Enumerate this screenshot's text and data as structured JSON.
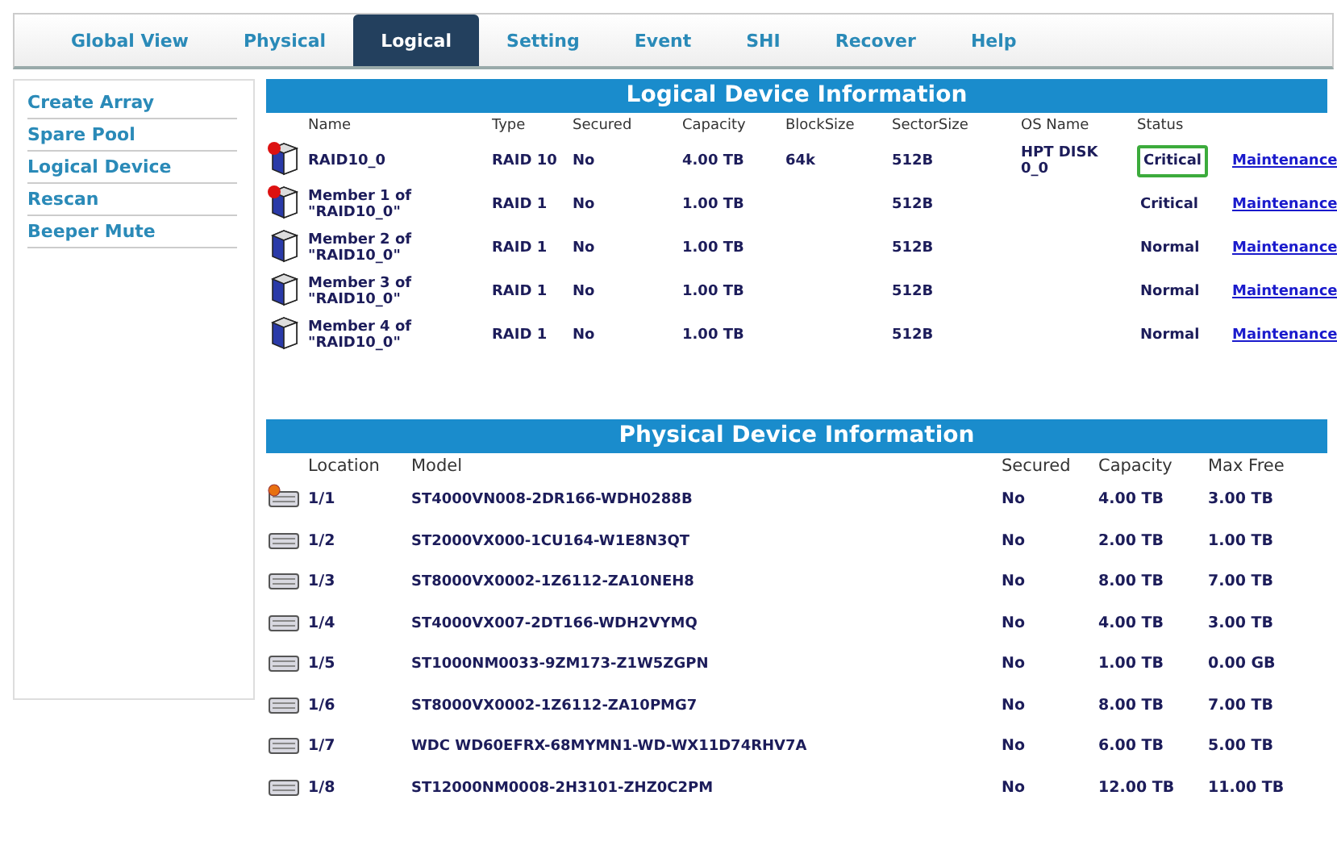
{
  "tabs": [
    {
      "label": "Global View",
      "selected": false
    },
    {
      "label": "Physical",
      "selected": false
    },
    {
      "label": "Logical",
      "selected": true
    },
    {
      "label": "Setting",
      "selected": false
    },
    {
      "label": "Event",
      "selected": false
    },
    {
      "label": "SHI",
      "selected": false
    },
    {
      "label": "Recover",
      "selected": false
    },
    {
      "label": "Help",
      "selected": false
    }
  ],
  "sidebar": {
    "items": [
      "Create Array",
      "Spare Pool",
      "Logical Device",
      "Rescan",
      "Beeper Mute"
    ]
  },
  "logical": {
    "title": "Logical Device Information",
    "columns": [
      "Name",
      "Type",
      "Secured",
      "Capacity",
      "BlockSize",
      "SectorSize",
      "OS Name",
      "Status"
    ],
    "rows": [
      {
        "name": "RAID10_0",
        "type": "RAID 10",
        "secured": "No",
        "capacity": "4.00 TB",
        "block_size": "64k",
        "sector_size": "512B",
        "os_name": "HPT DISK 0_0",
        "status": "Critical",
        "action": "Maintenance",
        "alert": true,
        "highlighted": true
      },
      {
        "name": "Member 1 of \"RAID10_0\"",
        "type": "RAID 1",
        "secured": "No",
        "capacity": "1.00 TB",
        "sector_size": "512B",
        "status": "Critical",
        "action": "Maintenance",
        "alert": true,
        "highlighted": false
      },
      {
        "name": "Member 2 of \"RAID10_0\"",
        "type": "RAID 1",
        "secured": "No",
        "capacity": "1.00 TB",
        "sector_size": "512B",
        "status": "Normal",
        "action": "Maintenance",
        "alert": false,
        "highlighted": false
      },
      {
        "name": "Member 3 of \"RAID10_0\"",
        "type": "RAID 1",
        "secured": "No",
        "capacity": "1.00 TB",
        "sector_size": "512B",
        "status": "Normal",
        "action": "Maintenance",
        "alert": false,
        "highlighted": false
      },
      {
        "name": "Member 4 of \"RAID10_0\"",
        "type": "RAID 1",
        "secured": "No",
        "capacity": "1.00 TB",
        "sector_size": "512B",
        "status": "Normal",
        "action": "Maintenance",
        "alert": false,
        "highlighted": false
      }
    ]
  },
  "physical": {
    "title": "Physical Device Information",
    "columns": [
      "Location",
      "Model",
      "Secured",
      "Capacity",
      "Max Free"
    ],
    "rows": [
      {
        "location": "1/1",
        "model": "ST4000VN008-2DR166-WDH0288B",
        "secured": "No",
        "capacity": "4.00 TB",
        "max_free": "3.00 TB",
        "alert": true
      },
      {
        "location": "1/2",
        "model": "ST2000VX000-1CU164-W1E8N3QT",
        "secured": "No",
        "capacity": "2.00 TB",
        "max_free": "1.00 TB",
        "alert": false
      },
      {
        "location": "1/3",
        "model": "ST8000VX0002-1Z6112-ZA10NEH8",
        "secured": "No",
        "capacity": "8.00 TB",
        "max_free": "7.00 TB",
        "alert": false
      },
      {
        "location": "1/4",
        "model": "ST4000VX007-2DT166-WDH2VYMQ",
        "secured": "No",
        "capacity": "4.00 TB",
        "max_free": "3.00 TB",
        "alert": false
      },
      {
        "location": "1/5",
        "model": "ST1000NM0033-9ZM173-Z1W5ZGPN",
        "secured": "No",
        "capacity": "1.00 TB",
        "max_free": "0.00 GB",
        "alert": false
      },
      {
        "location": "1/6",
        "model": "ST8000VX0002-1Z6112-ZA10PMG7",
        "secured": "No",
        "capacity": "8.00 TB",
        "max_free": "7.00 TB",
        "alert": false
      },
      {
        "location": "1/7",
        "model": "WDC WD60EFRX-68MYMN1-WD-WX11D74RHV7A",
        "secured": "No",
        "capacity": "6.00 TB",
        "max_free": "5.00 TB",
        "alert": false
      },
      {
        "location": "1/8",
        "model": "ST12000NM0008-2H3101-ZHZ0C2PM",
        "secured": "No",
        "capacity": "12.00 TB",
        "max_free": "11.00 TB",
        "alert": false
      }
    ]
  }
}
